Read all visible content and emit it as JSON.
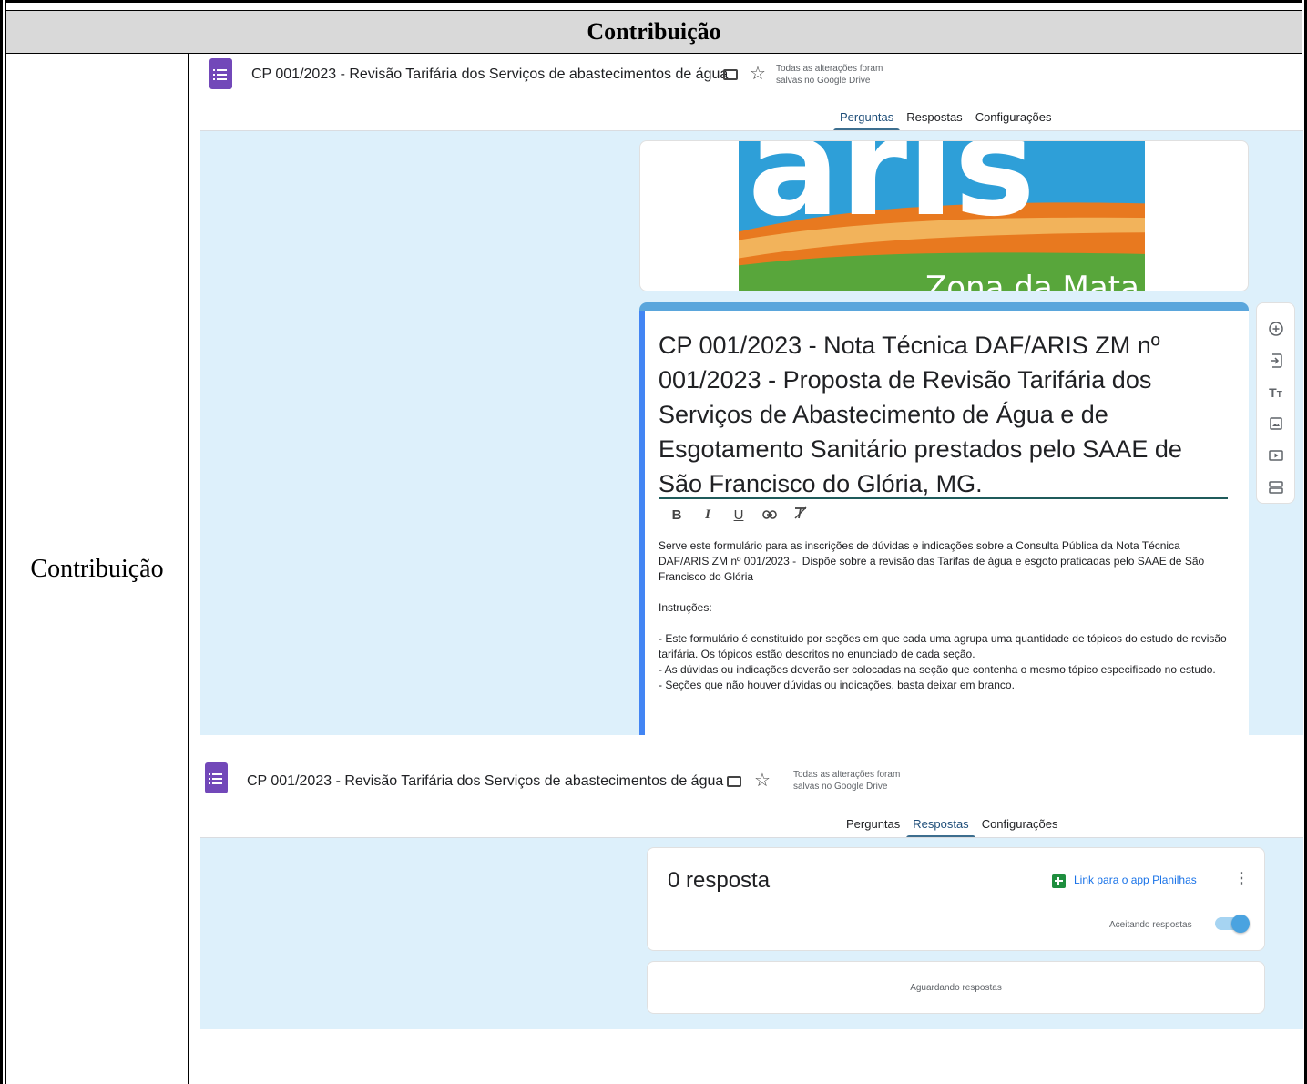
{
  "document": {
    "header": "Contribuição",
    "row_label": "Contribuição"
  },
  "shot1": {
    "doc_title": "CP 001/2023 - Revisão Tarifária dos Serviços de abastecimentos de água",
    "saved_note_line1": "Todas as alterações foram",
    "saved_note_line2": "salvas no Google Drive",
    "tabs": [
      {
        "label": "Perguntas",
        "active": true
      },
      {
        "label": "Respostas",
        "active": false
      },
      {
        "label": "Configurações",
        "active": false
      }
    ],
    "banner_text": "Zona da Mata",
    "banner_logo": "aris",
    "form_title": "CP 001/2023 - Nota Técnica DAF/ARIS ZM nº 001/2023 -  Proposta de Revisão Tarifária dos Serviços de Abastecimento de Água e de Esgotamento Sanitário prestados pelo SAAE de São Francisco do Glória, MG.",
    "format_buttons": [
      "B",
      "I",
      "U",
      "link-icon",
      "clear-format-icon"
    ],
    "description": "Serve este formulário para as inscrições de dúvidas e indicações sobre a Consulta Pública da Nota Técnica DAF/ARIS ZM nº 001/2023 -  Dispõe sobre a revisão das Tarifas de água e esgoto praticadas pelo SAAE de São Francisco do Glória\n\nInstruções:\n\n- Este formulário é constituído por seções em que cada uma agrupa uma quantidade de tópicos do estudo de revisão tarifária. Os tópicos estão descritos no enunciado de cada seção.\n- As dúvidas ou indicações deverão ser colocadas na seção que contenha o mesmo tópico especificado no estudo.\n- Seções que não houver dúvidas ou indicações, basta deixar em branco.",
    "toolbar": [
      "add-question-icon",
      "import-questions-icon",
      "add-title-icon",
      "add-image-icon",
      "add-video-icon",
      "add-section-icon"
    ]
  },
  "shot2": {
    "doc_title": "CP 001/2023 - Revisão Tarifária dos Serviços de abastecimentos de água",
    "saved_note_line1": "Todas as alterações foram",
    "saved_note_line2": "salvas no Google Drive",
    "tabs": [
      {
        "label": "Perguntas",
        "active": false
      },
      {
        "label": "Respostas",
        "active": true
      },
      {
        "label": "Configurações",
        "active": false
      }
    ],
    "response_count": "0 resposta",
    "sheets_link": "Link para o app Planilhas",
    "accepting_label": "Aceitando respostas",
    "accepting": true,
    "waiting_text": "Aguardando respostas"
  },
  "colors": {
    "forms_purple": "#7248b9",
    "form_background": "#ddf0fb",
    "accent_blue": "#4285f4",
    "sheets_green": "#1e8e3e",
    "link_blue": "#1a73e8"
  }
}
